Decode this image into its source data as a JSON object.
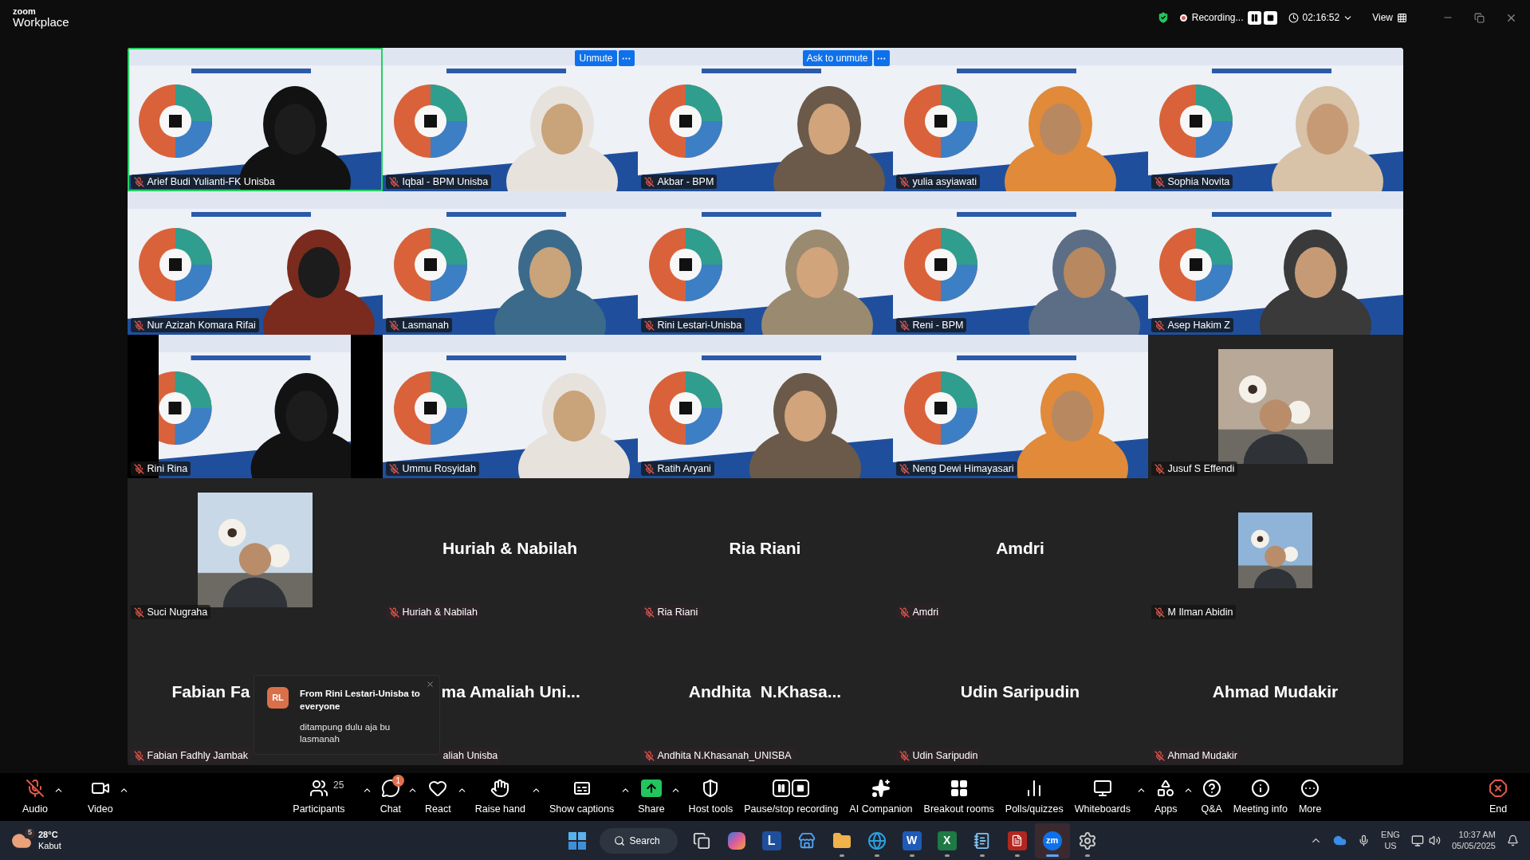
{
  "app": {
    "brand": "zoom",
    "product": "Workplace"
  },
  "top_bar": {
    "recording_label": "Recording...",
    "recording_paused": false,
    "timer": "02:16:52",
    "view_label": "View"
  },
  "tiles": [
    {
      "kind": "video",
      "name": "Arief Budi Yulianti-FK Unisba",
      "muted": true,
      "active": true
    },
    {
      "kind": "video",
      "name": "Iqbal - BPM Unisba",
      "muted": true,
      "active": false,
      "action": "Unmute"
    },
    {
      "kind": "video",
      "name": "Akbar - BPM",
      "muted": true,
      "active": false,
      "action": "Ask to unmute"
    },
    {
      "kind": "video",
      "name": "yulia asyiawati",
      "muted": true,
      "active": false
    },
    {
      "kind": "video",
      "name": "Sophia Novita",
      "muted": true,
      "active": false
    },
    {
      "kind": "video",
      "name": "Nur Azizah Komara Rifai",
      "muted": true,
      "active": false
    },
    {
      "kind": "video",
      "name": "Lasmanah",
      "muted": true,
      "active": false
    },
    {
      "kind": "video",
      "name": "Rini Lestari-Unisba",
      "muted": true,
      "active": false
    },
    {
      "kind": "video",
      "name": "Reni - BPM",
      "muted": true,
      "active": false
    },
    {
      "kind": "video",
      "name": "Asep Hakim Z",
      "muted": true,
      "active": false
    },
    {
      "kind": "video",
      "name": "Rini Rina",
      "muted": true,
      "active": false
    },
    {
      "kind": "video",
      "name": "Ummu Rosyidah",
      "muted": true,
      "active": false
    },
    {
      "kind": "video",
      "name": "Ratih Aryani",
      "muted": true,
      "active": false
    },
    {
      "kind": "video",
      "name": "Neng Dewi Himayasari",
      "muted": true,
      "active": false
    },
    {
      "name": "Jusuf S Effendi",
      "muted": true,
      "active": false
    },
    {
      "name": "Suci Nugraha",
      "muted": true,
      "active": false
    },
    {
      "kind": "name",
      "display": "Huriah & Nabilah",
      "name": "Huriah & Nabilah",
      "muted": true,
      "active": false
    },
    {
      "kind": "name",
      "display": "Ria Riani",
      "name": "Ria Riani",
      "muted": true,
      "active": false
    },
    {
      "kind": "name",
      "display": "Amdri",
      "name": "Amdri",
      "muted": true,
      "active": false
    },
    {
      "name": "M Ilman Abidin",
      "muted": true,
      "active": false
    },
    {
      "kind": "name",
      "display": "Fabian Fa",
      "name": "Fabian Fadhly Jambak",
      "muted": true,
      "active": false
    },
    {
      "kind": "name",
      "display": "ma Amaliah Uni...",
      "name": "aliah Unisba",
      "active": false
    },
    {
      "kind": "name",
      "display": "Andhita  N.Khasa...",
      "name": "Andhita N.Khasanah_UNISBA",
      "muted": true,
      "active": false
    },
    {
      "kind": "name",
      "display": "Udin Saripudin",
      "name": "Udin Saripudin",
      "muted": true,
      "active": false
    },
    {
      "kind": "name",
      "display": "Ahmad Mudakir",
      "name": "Ahmad Mudakir",
      "muted": true,
      "active": false
    }
  ],
  "chat_popup": {
    "initials": "RL",
    "title": "From Rini Lestari-Unisba to everyone",
    "message": "ditampung dulu aja bu lasmanah"
  },
  "toolbar": [
    {
      "kind": "audio",
      "label": "Audio",
      "muted": true,
      "menu": true
    },
    {
      "kind": "video",
      "label": "Video",
      "menu": true
    },
    {
      "kind": "participants",
      "label": "Participants",
      "count": "25",
      "menu": true
    },
    {
      "kind": "chat",
      "label": "Chat",
      "badge": "1",
      "menu": true
    },
    {
      "kind": "react",
      "label": "React",
      "menu": true
    },
    {
      "kind": "hand",
      "label": "Raise hand",
      "menu": true
    },
    {
      "kind": "captions",
      "label": "Show captions",
      "menu": true
    },
    {
      "kind": "share",
      "label": "Share",
      "menu": true
    },
    {
      "kind": "host",
      "label": "Host tools",
      "menu": false
    },
    {
      "kind": "record",
      "label": "Pause/stop recording",
      "menu": false
    },
    {
      "kind": "ai",
      "label": "AI Companion",
      "menu": false
    },
    {
      "kind": "breakout",
      "label": "Breakout rooms",
      "menu": false
    },
    {
      "kind": "polls",
      "label": "Polls/quizzes",
      "menu": false
    },
    {
      "kind": "whiteboards",
      "label": "Whiteboards",
      "menu": true
    },
    {
      "kind": "apps",
      "label": "Apps",
      "menu": true
    },
    {
      "kind": "qa",
      "label": "Q&A",
      "menu": false
    },
    {
      "kind": "info",
      "label": "Meeting info",
      "menu": false
    },
    {
      "kind": "more",
      "label": "More",
      "menu": false
    },
    {
      "kind": "end",
      "label": "End",
      "menu": false
    }
  ],
  "taskbar": {
    "weather": {
      "badge": "5",
      "temp": "28°C",
      "condition": "Kabut"
    },
    "search": "Search",
    "apps": [
      {
        "kind": "taskview",
        "running": false,
        "active": false
      },
      {
        "kind": "copilot",
        "running": false,
        "active": false
      },
      {
        "kind": "letter",
        "text": "L",
        "running": false,
        "active": false
      },
      {
        "kind": "store",
        "running": false,
        "active": false
      },
      {
        "kind": "folder",
        "running": true,
        "active": false
      },
      {
        "kind": "edge",
        "running": true,
        "active": false
      },
      {
        "kind": "word",
        "text": "W",
        "running": true,
        "active": false
      },
      {
        "kind": "excel",
        "text": "X",
        "running": true,
        "active": false
      },
      {
        "kind": "notepad",
        "running": true,
        "active": false
      },
      {
        "kind": "acrobat",
        "running": true,
        "active": false
      },
      {
        "kind": "zoom",
        "text": "zm",
        "running": true,
        "active": true
      },
      {
        "kind": "settings",
        "running": true,
        "active": false
      }
    ],
    "lang": "ENG",
    "region": "US",
    "time": "10:37 AM",
    "date": "05/05/2025"
  }
}
